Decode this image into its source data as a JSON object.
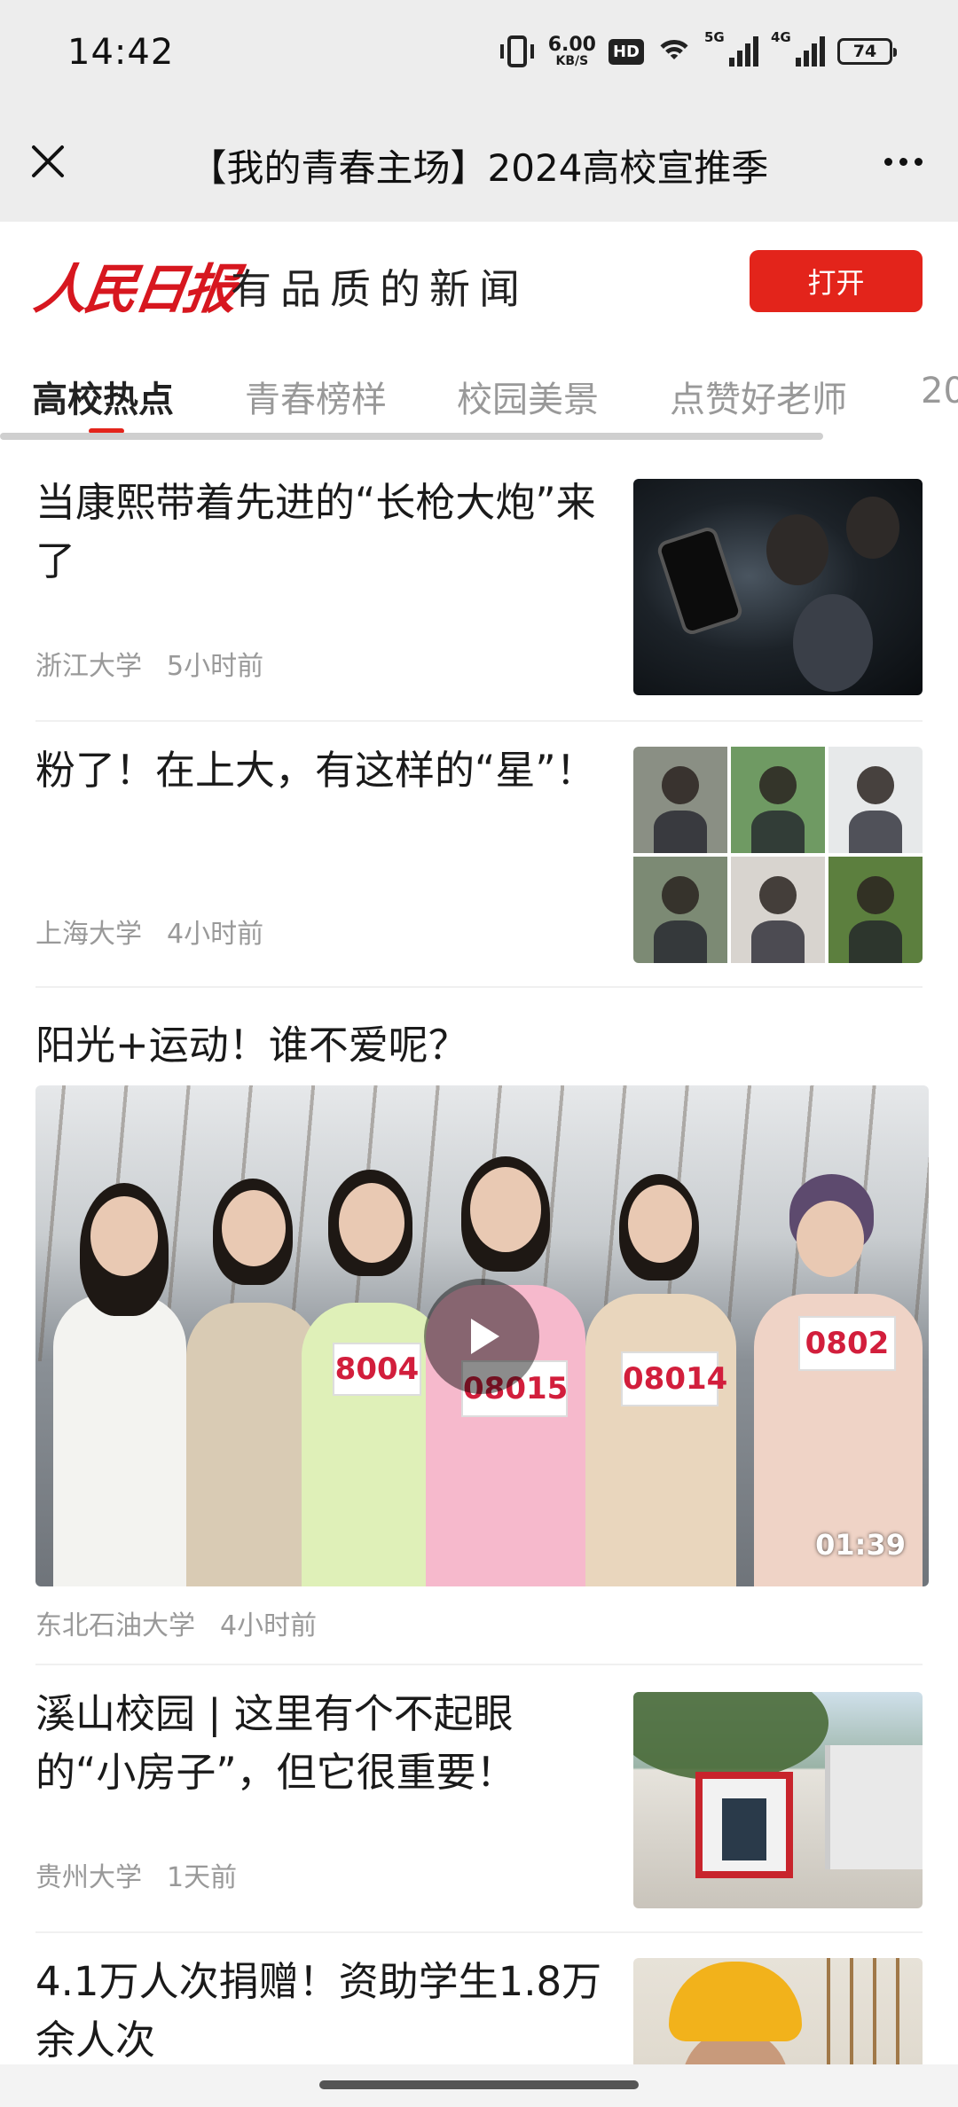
{
  "status_bar": {
    "time": "14:42",
    "net_speed_value": "6.00",
    "net_speed_unit": "KB/S",
    "hd_badge": "HD",
    "signal1_label": "5G",
    "signal2_label": "4G",
    "battery": "74"
  },
  "titlebar": {
    "title": "【我的青春主场】2024高校宣推季",
    "close_icon": "close-icon",
    "more_icon": "more-icon"
  },
  "banner": {
    "logo_text": "人民日报",
    "slogan": "有品质的新闻",
    "open_label": "打开",
    "accent_color": "#e3241b"
  },
  "tabs": [
    {
      "label": "高校热点",
      "active": true
    },
    {
      "label": "青春榜样",
      "active": false
    },
    {
      "label": "校园美景",
      "active": false
    },
    {
      "label": "点赞好老师",
      "active": false
    },
    {
      "label": "20",
      "active": false
    }
  ],
  "articles": [
    {
      "title": "当康熙带着先进的“长枪大炮”来了",
      "source": "浙江大学",
      "time": "5小时前"
    },
    {
      "title": "粉了！在上大，有这样的“星”！",
      "source": "上海大学",
      "time": "4小时前"
    },
    {
      "title": "溪山校园 | 这里有个不起眼的“小房子”，但它很重要！",
      "source": "贵州大学",
      "time": "1天前"
    },
    {
      "title": "4.1万人次捐赠！资助学生1.8万余人次",
      "source": "",
      "time": ""
    }
  ],
  "video_article": {
    "title": "阳光+运动！谁不爱呢？",
    "duration": "01:39",
    "source": "东北石油大学",
    "time": "4小时前",
    "bib_numbers": [
      "8004",
      "08015",
      "08014",
      "0802"
    ]
  }
}
